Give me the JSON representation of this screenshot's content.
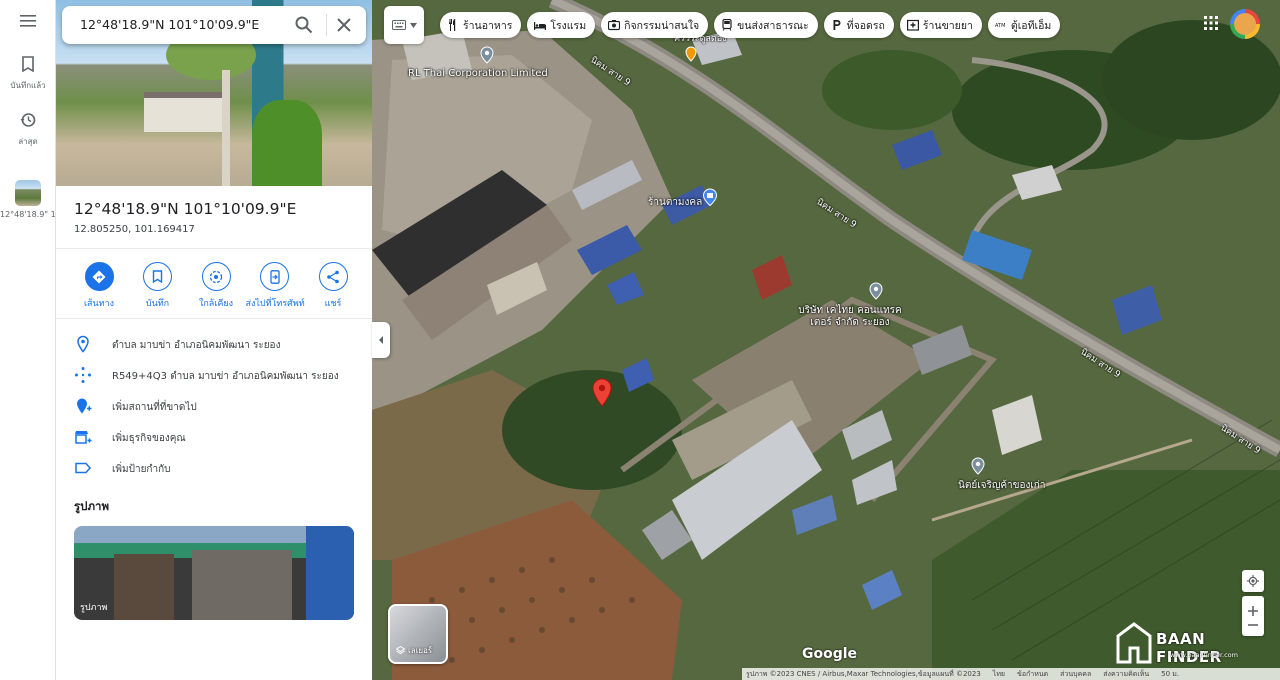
{
  "rail": {
    "saved_label": "บันทึกแล้ว",
    "recent_label": "ล่าสุด",
    "place_label": "12°48'18.9\" 101°10'09.9"
  },
  "search": {
    "query": "12°48'18.9\"N 101°10'09.9\"E"
  },
  "place": {
    "title": "12°48'18.9\"N 101°10'09.9\"E",
    "decimal_coords": "12.805250, 101.169417"
  },
  "actions": [
    {
      "label": "เส้นทาง",
      "icon": "directions-icon"
    },
    {
      "label": "บันทึก",
      "icon": "bookmark-icon"
    },
    {
      "label": "ใกล้เคียง",
      "icon": "nearby-icon"
    },
    {
      "label": "ส่งไปที่โทรศัพท์",
      "icon": "send-to-phone-icon"
    },
    {
      "label": "แชร์",
      "icon": "share-icon"
    }
  ],
  "info_rows": [
    {
      "text": "ตำบล มาบข่า อำเภอนิคมพัฒนา ระยอง",
      "icon": "location-pin-icon"
    },
    {
      "text": "R549+4Q3 ตำบล มาบข่า อำเภอนิคมพัฒนา ระยอง",
      "icon": "plus-code-icon"
    },
    {
      "text": "เพิ่มสถานที่ที่ขาดไป",
      "icon": "add-place-icon"
    },
    {
      "text": "เพิ่มธุรกิจของคุณ",
      "icon": "add-business-icon"
    },
    {
      "text": "เพิ่มป้ายกำกับ",
      "icon": "label-icon"
    }
  ],
  "photos": {
    "heading": "รูปภาพ",
    "caption": "รูปภาพ"
  },
  "chips": [
    {
      "label": "ร้านอาหาร",
      "icon": "restaurant-icon"
    },
    {
      "label": "โรงแรม",
      "icon": "hotel-icon"
    },
    {
      "label": "กิจกรรมน่าสนใจ",
      "icon": "camera-icon"
    },
    {
      "label": "ขนส่งสาธารณะ",
      "icon": "transit-icon"
    },
    {
      "label": "ที่จอดรถ",
      "icon": "parking-icon"
    },
    {
      "label": "ร้านขายยา",
      "icon": "pharmacy-icon"
    },
    {
      "label": "ตู้เอทีเอ็ม",
      "icon": "atm-icon"
    }
  ],
  "map_labels": {
    "rl_thai": "RL Thai Corporation Limited",
    "shop_mongkol": "ร้านตามงคล",
    "kc_thai": "บริษัท เคไทย คอนแทรค เตอร์ จำกัด ระยอง",
    "old_goods": "นิตย์เจริญค้าของเก่า",
    "partial_top": "ครัวระดูลดอง",
    "road_1": "นิคม สาย 9",
    "road_2": "นิคม สาย 9",
    "road_3": "นิคม สาย 9",
    "road_4": "นิคม สาย 9"
  },
  "layers": {
    "label": "เลเยอร์"
  },
  "brand": {
    "google": "Google"
  },
  "footer": {
    "imagery": "รูปภาพ ©2023 CNES / Airbus,Maxar Technologies,ข้อมูลแผนที่ ©2023",
    "thailand": "ไทย",
    "terms": "ข้อกำหนด",
    "privacy": "ส่วนบุคคล",
    "feedback": "ส่งความคิดเห็น",
    "scale": "50 ม."
  },
  "watermark": {
    "title": "BAAN FINDER",
    "url": "www.baanfinder.com"
  },
  "colors": {
    "accent": "#1a73e8",
    "pin": "#ea4335"
  }
}
